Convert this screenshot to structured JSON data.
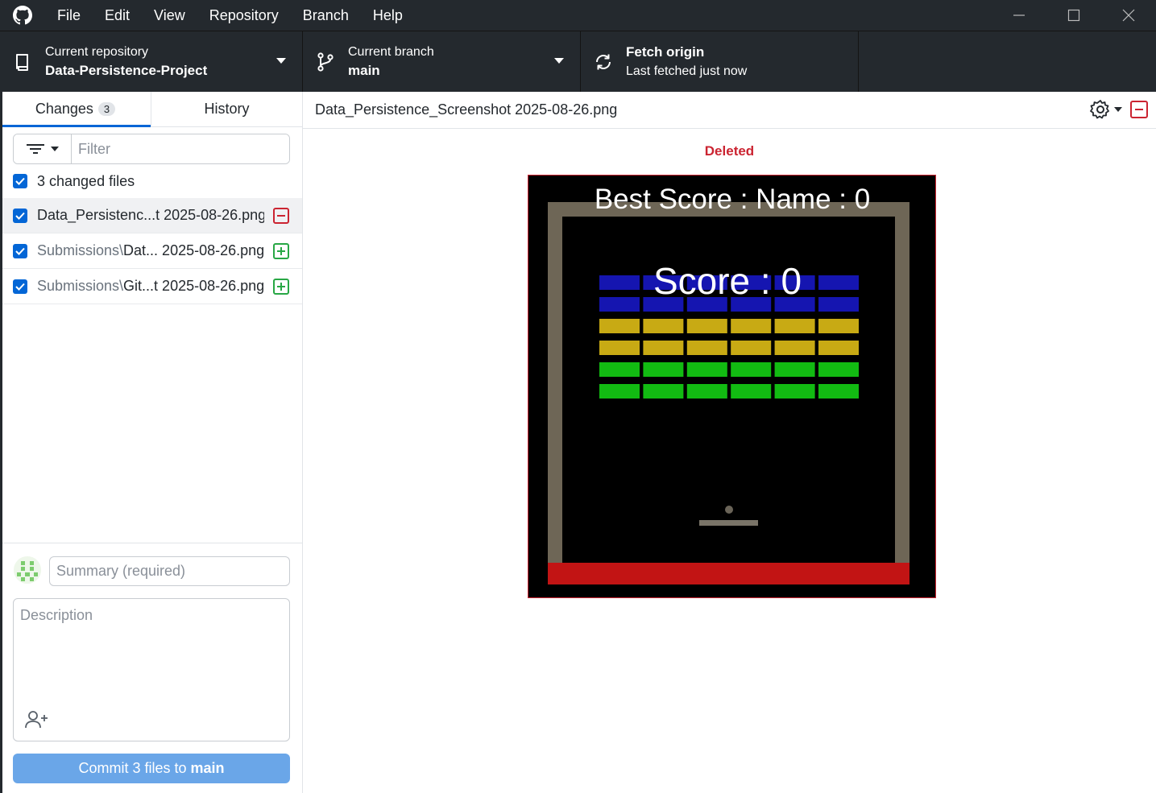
{
  "menu": [
    "File",
    "Edit",
    "View",
    "Repository",
    "Branch",
    "Help"
  ],
  "toolbar": {
    "repo_label": "Current repository",
    "repo_value": "Data-Persistence-Project",
    "branch_label": "Current branch",
    "branch_value": "main",
    "fetch_label": "Fetch origin",
    "fetch_status": "Last fetched just now"
  },
  "tabs": {
    "changes_label": "Changes",
    "changes_count": "3",
    "history_label": "History"
  },
  "filter": {
    "placeholder": "Filter"
  },
  "changed_files_label": "3 changed files",
  "files": [
    {
      "dir": "",
      "name": "Data_Persistenc...t 2025-08-26.png",
      "status": "deleted"
    },
    {
      "dir": "Submissions\\",
      "name": "Dat... 2025-08-26.png",
      "status": "added"
    },
    {
      "dir": "Submissions\\",
      "name": "Git...t 2025-08-26.png",
      "status": "added"
    }
  ],
  "commit": {
    "summary_placeholder": "Summary (required)",
    "description_placeholder": "Description",
    "button_prefix": "Commit 3 files to",
    "button_branch": "main"
  },
  "diff": {
    "file_title": "Data_Persistence_Screenshot 2025-08-26.png",
    "status_label": "Deleted"
  },
  "game_image": {
    "best_score_text": "Best Score : Name : 0",
    "score_text": "Score : 0",
    "brick_rows": [
      "#1515b0",
      "#1515b0",
      "#c8aa14",
      "#c8aa14",
      "#12bb12",
      "#12bb12"
    ],
    "bricks_per_row": 6
  },
  "colors": {
    "titlebar": "#24292e",
    "accent": "#0366d6",
    "deleted": "#cb2431",
    "added": "#28a745"
  }
}
